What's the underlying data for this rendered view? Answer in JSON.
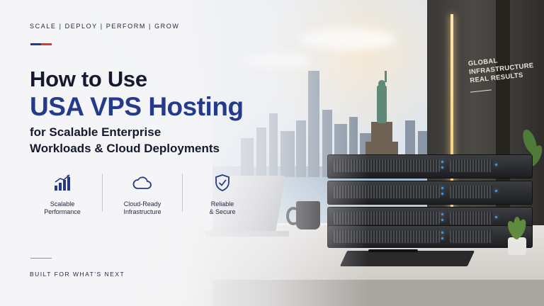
{
  "tagline": "SCALE  |  DEPLOY  |  PERFORM  |  GROW",
  "headline": {
    "line1": "How to Use",
    "line2": "USA VPS Hosting",
    "sub1": "for Scalable Enterprise",
    "sub2": "Workloads & Cloud Deployments"
  },
  "features": [
    {
      "icon": "bar-chart-icon",
      "label1": "Scalable",
      "label2": "Performance"
    },
    {
      "icon": "cloud-icon",
      "label1": "Cloud-Ready",
      "label2": "Infrastructure"
    },
    {
      "icon": "shield-check-icon",
      "label1": "Reliable",
      "label2": "& Secure"
    }
  ],
  "footer": "BUILT FOR WHAT'S NEXT",
  "frame_text": {
    "line1": "GLOBAL",
    "line2": "INFRASTRUCTURE",
    "line3": "REAL RESULTS"
  },
  "colors": {
    "navy": "#14192e",
    "accent_blue": "#253a8a",
    "flag_blue": "#253a8a",
    "flag_red": "#d23a3a"
  }
}
